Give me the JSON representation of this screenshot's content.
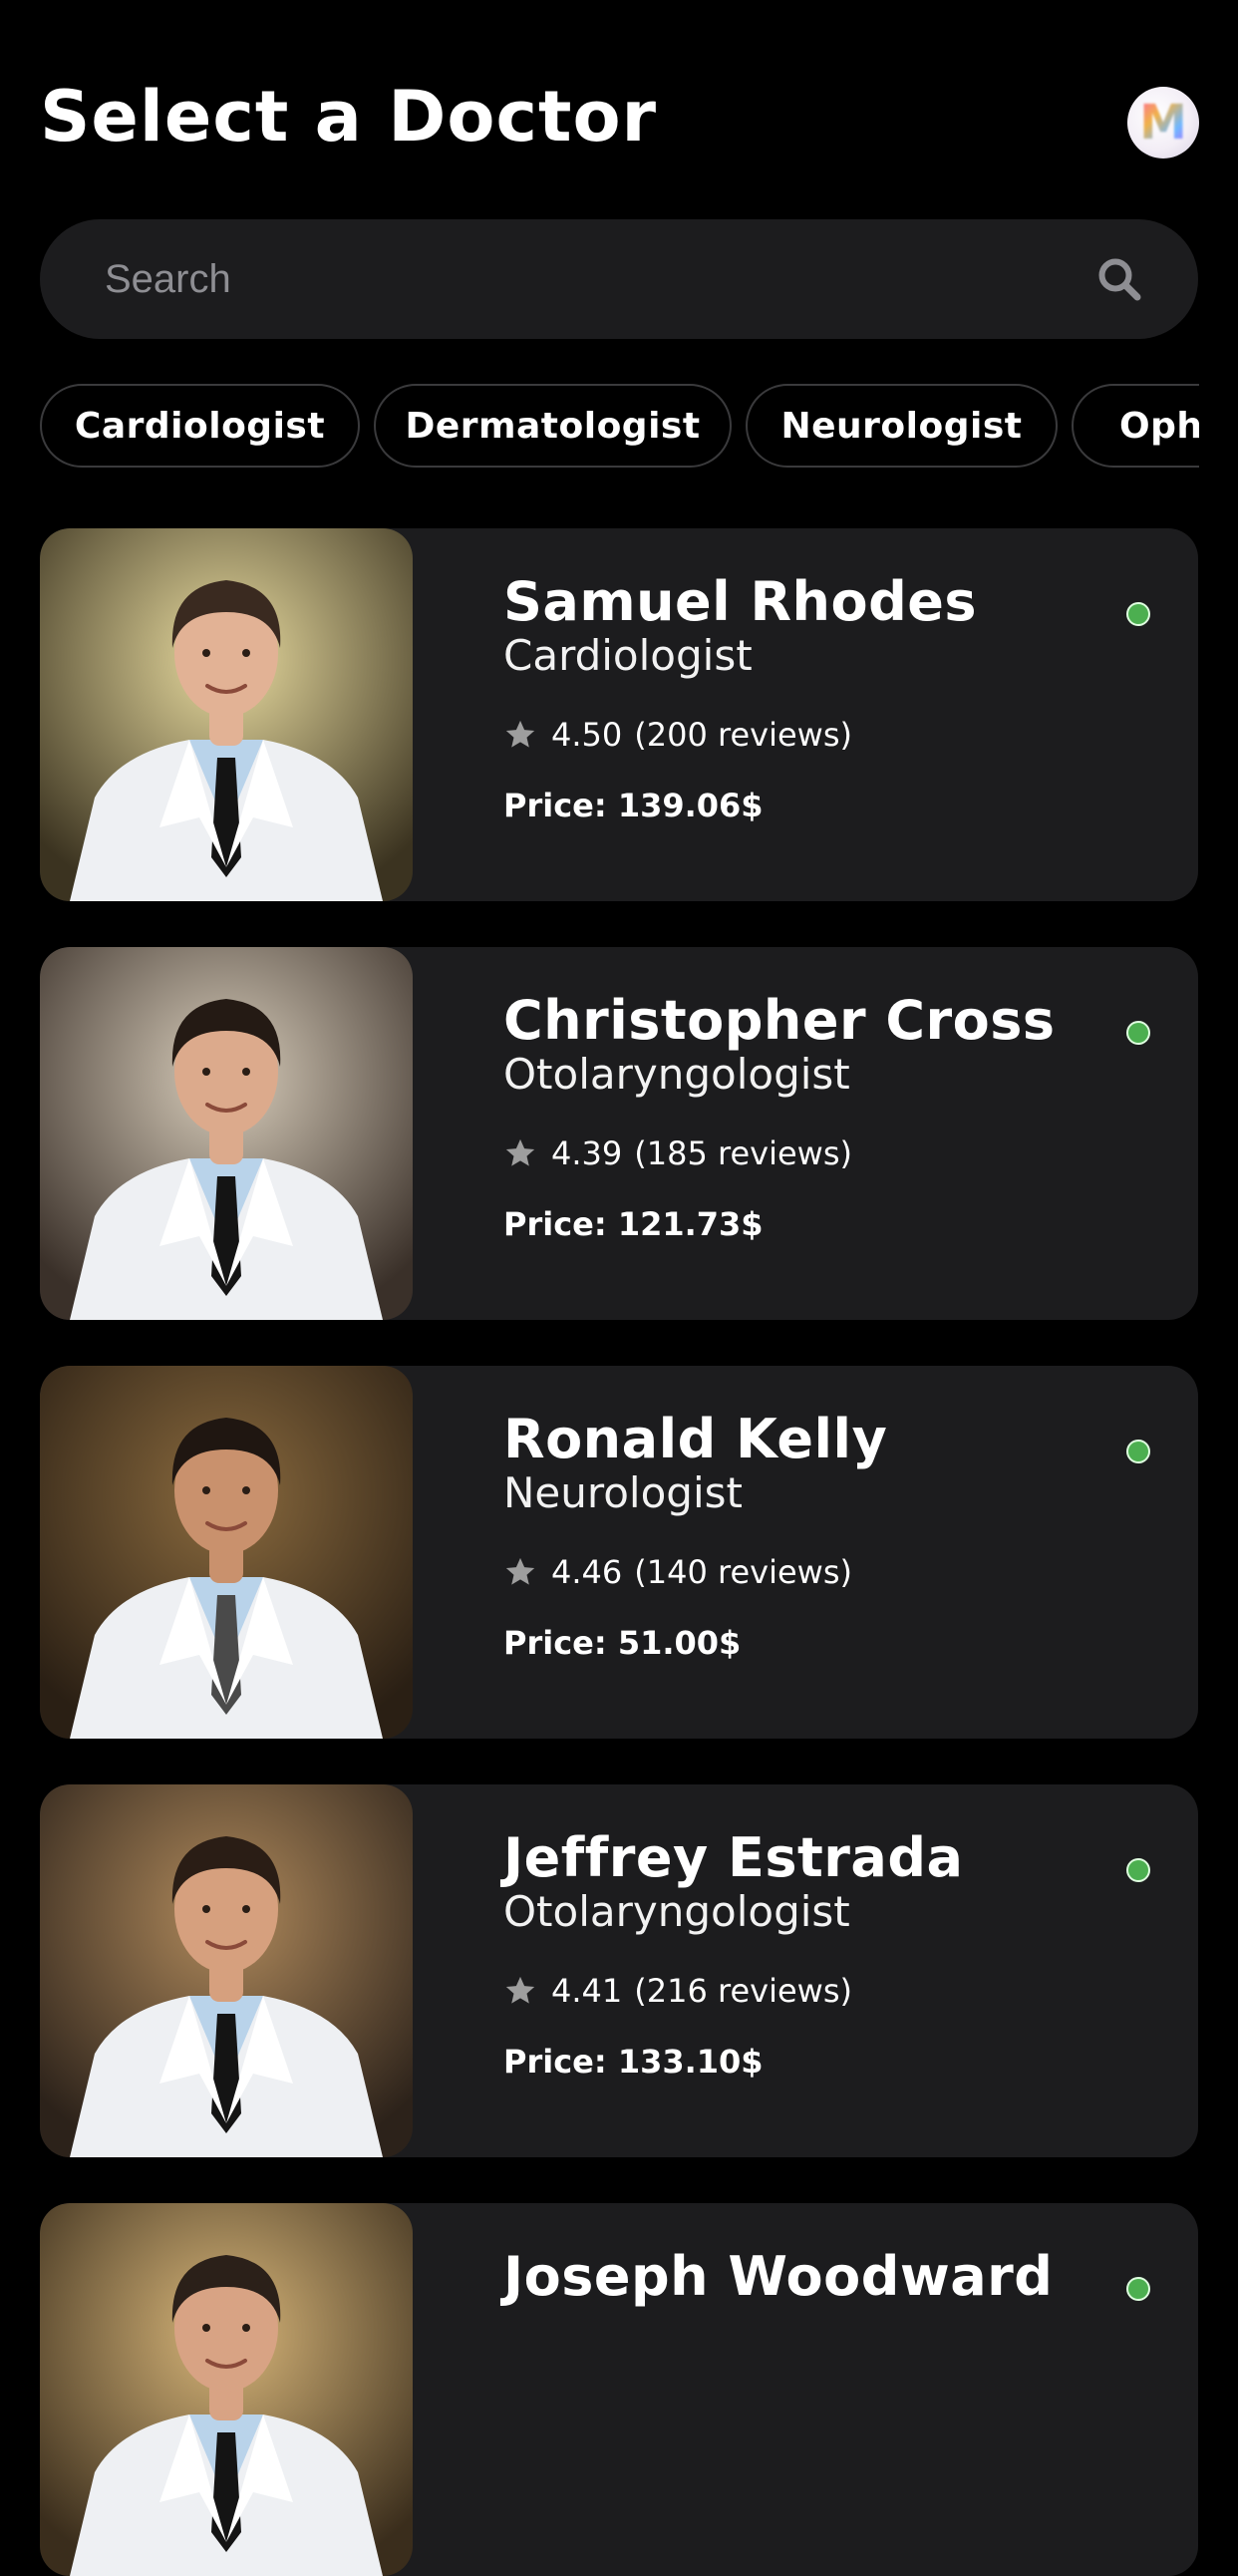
{
  "header": {
    "title": "Select a Doctor",
    "avatar_letter": "M"
  },
  "search": {
    "placeholder": "Search",
    "value": ""
  },
  "filters": [
    {
      "label": "Cardiologist"
    },
    {
      "label": "Dermatologist"
    },
    {
      "label": "Neurologist"
    },
    {
      "label": "Oph"
    }
  ],
  "doctors": [
    {
      "name": "Samuel Rhodes",
      "specialty": "Cardiologist",
      "rating": "4.50",
      "reviews": "(200 reviews)",
      "price": "Price: 139.06$",
      "online": true,
      "tie": "black"
    },
    {
      "name": "Christopher Cross",
      "specialty": "Otolaryngologist",
      "rating": "4.39",
      "reviews": "(185 reviews)",
      "price": "Price: 121.73$",
      "online": true,
      "tie": "black"
    },
    {
      "name": "Ronald Kelly",
      "specialty": "Neurologist",
      "rating": "4.46",
      "reviews": "(140 reviews)",
      "price": "Price: 51.00$",
      "online": true,
      "tie": "gray"
    },
    {
      "name": "Jeffrey Estrada",
      "specialty": "Otolaryngologist",
      "rating": "4.41",
      "reviews": "(216 reviews)",
      "price": "Price: 133.10$",
      "online": true,
      "tie": "black"
    },
    {
      "name": "Joseph Woodward",
      "specialty": "",
      "rating": "",
      "reviews": "",
      "price": "",
      "online": true,
      "tie": "black"
    }
  ],
  "colors": {
    "background": "#000000",
    "card": "#1c1c1e",
    "online": "#4caf50",
    "star": "#9e9e9e",
    "placeholder": "#8e8e93"
  },
  "icons": {
    "search": "search-icon",
    "rating": "star-icon",
    "online": "status-dot"
  }
}
